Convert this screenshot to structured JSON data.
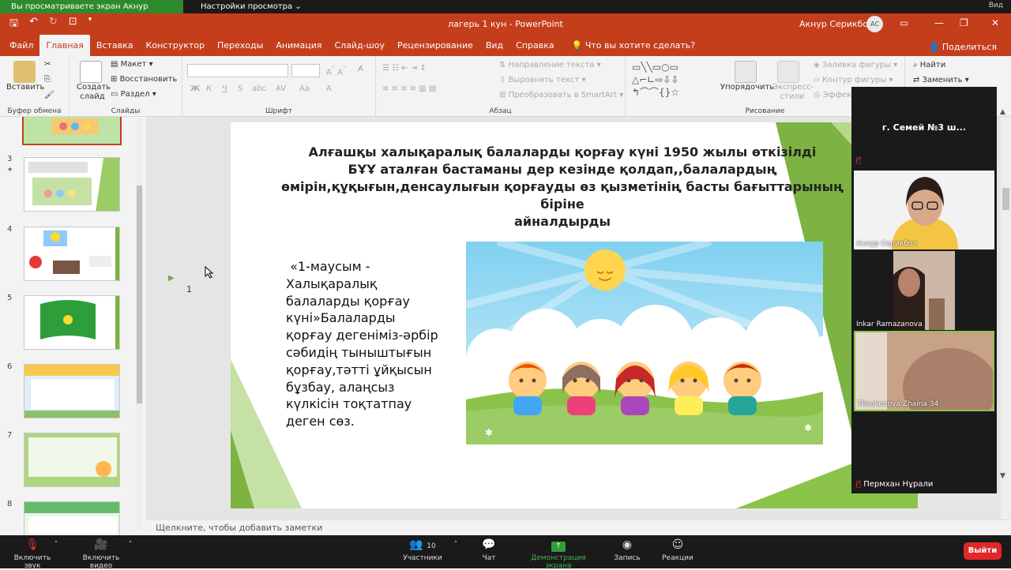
{
  "zoom": {
    "share_banner": "Вы просматриваете экран Акнур Серикбол",
    "view_options": "Настройки просмотра",
    "view_label": "Вид"
  },
  "titlebar": {
    "title": "лагерь 1 кун  -  PowerPoint",
    "user": "Акнур Серикбол",
    "avatar": "АС"
  },
  "menu": {
    "items": [
      "Файл",
      "Главная",
      "Вставка",
      "Конструктор",
      "Переходы",
      "Анимация",
      "Слайд-шоу",
      "Рецензирование",
      "Вид",
      "Справка"
    ],
    "active_index": 1,
    "tell_me": "Что вы хотите сделать?",
    "share": "Поделиться"
  },
  "ribbon": {
    "paste": "Вставить",
    "clipboard": "Буфер обмена",
    "new_slide": "Создать слайд",
    "layout": "Макет",
    "reset": "Восстановить",
    "section": "Раздел",
    "slides": "Слайды",
    "font": "Шрифт",
    "paragraph": "Абзац",
    "text_direction": "Направление текста",
    "align_text": "Выровнять текст",
    "smartart": "Преобразовать в SmartArt",
    "arrange": "Упорядочить",
    "quick_styles": "Экспресс-стили",
    "shape_fill": "Заливка фигуры",
    "shape_outline": "Контур фигуры",
    "shape_effects": "Эффекты",
    "drawing": "Рисование",
    "find": "Найти",
    "replace": "Заменить"
  },
  "thumbnails": [
    {
      "num": "3"
    },
    {
      "num": "4"
    },
    {
      "num": "5"
    },
    {
      "num": "6"
    },
    {
      "num": "7"
    },
    {
      "num": "8"
    }
  ],
  "slide": {
    "number": "1",
    "title_lines": [
      "Алғашқы халықаралық балаларды қорғау күні 1950 жылы өткізілді",
      "БҰҰ аталған бастаманы дер кезінде қолдап,,балалардың",
      "өмірін,құқығын,денсаулығын қорғауды өз қызметінің басты бағыттарының біріне",
      "айналдырды"
    ],
    "body_lines": [
      " «1-маусым -",
      "Халықаралық",
      "балаларды қорғау",
      "күні»Балаларды",
      "қорғау дегеніміз-әрбір",
      "сәбидің тыныштығын",
      "қорғау,тәтті ұйқысын",
      "бұзбау, алаңсыз",
      "күлкісін тоқтатпау",
      "деген сөз."
    ]
  },
  "notes": {
    "placeholder": "Щелкните, чтобы добавить заметки"
  },
  "participants": {
    "title": "г. Семей №3 ш...",
    "tiles": [
      {
        "name": "Акнур Серикбол"
      },
      {
        "name": "Inkar Ramazanova"
      },
      {
        "name": "Tileukenova Zhaina 34"
      },
      {
        "name": "Пермхан Нұрали"
      }
    ]
  },
  "zoom_bar": {
    "mute": "Включить звук",
    "video": "Включить видео",
    "participants": "Участники",
    "participants_count": "10",
    "chat": "Чат",
    "share": "Демонстрация экрана",
    "record": "Запись",
    "reactions": "Реакции",
    "exit": "Выйти"
  },
  "colors": {
    "accent": "#c43e1c",
    "share_green": "#2d8a2d",
    "slide_green": "#7cb342",
    "exit_red": "#e02828"
  }
}
